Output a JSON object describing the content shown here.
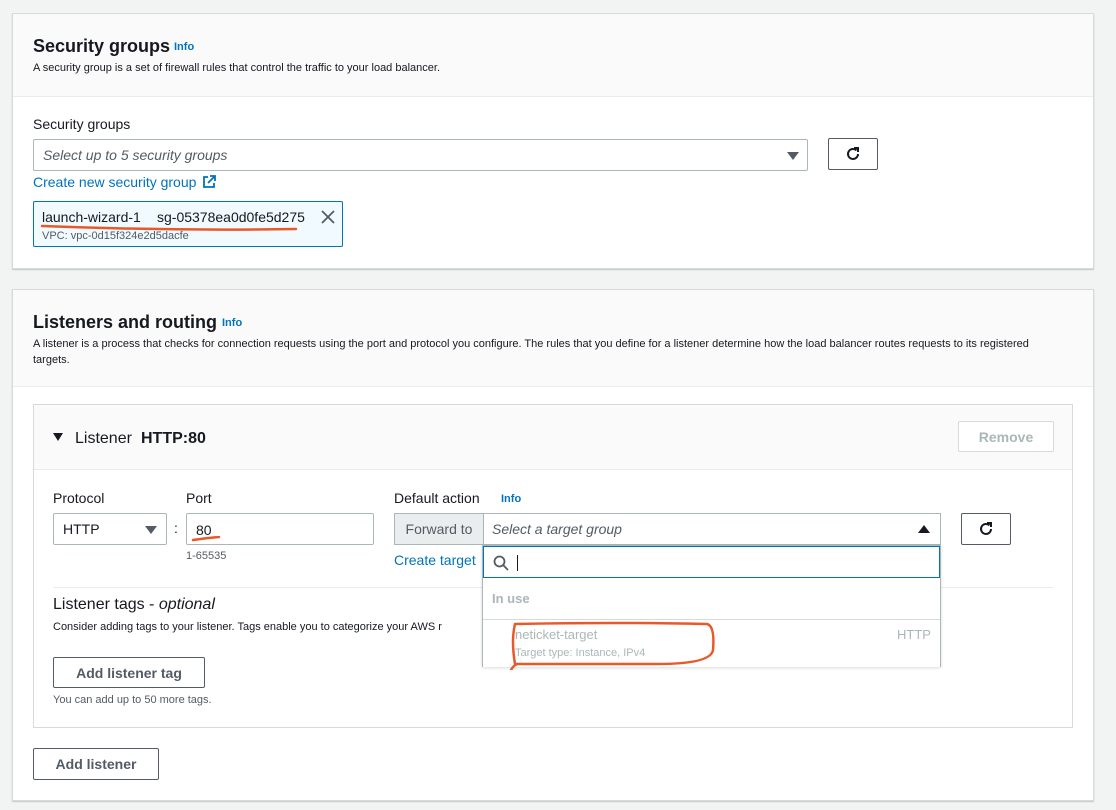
{
  "security_groups": {
    "title": "Security groups",
    "info": "Info",
    "description": "A security group is a set of firewall rules that control the traffic to your load balancer.",
    "field_label": "Security groups",
    "select_placeholder": "Select up to 5 security groups",
    "create_link": "Create new security group",
    "selected_token": {
      "name": "launch-wizard-1",
      "id": "sg-05378ea0d0fe5d275",
      "vpc": "VPC: vpc-0d15f324e2d5dacfe"
    }
  },
  "listeners": {
    "title": "Listeners and routing",
    "info": "Info",
    "description": "A listener is a process that checks for connection requests using the port and protocol you configure. The rules that you define for a listener determine how the load balancer routes requests to its registered targets.",
    "listener": {
      "name": "Listener",
      "protocol_port": "HTTP:80",
      "remove_label": "Remove",
      "protocol_label": "Protocol",
      "protocol_value": "HTTP",
      "colon": ":",
      "port_label": "Port",
      "port_value": "80",
      "port_hint": "1-65535",
      "default_action_label": "Default action",
      "default_action_info": "Info",
      "forward_to": "Forward to",
      "target_placeholder": "Select a target group",
      "create_target_link": "Create target",
      "tags_title": "Listener tags",
      "tags_optional": "optional",
      "tags_desc": "Consider adding tags to your listener. Tags enable you to categorize your AWS r",
      "add_tag_label": "Add listener tag",
      "tags_hint": "You can add up to 50 more tags."
    },
    "dropdown": {
      "group_label": "In use",
      "option_name": "neticket-target",
      "option_protocol": "HTTP",
      "option_desc": "Target type: Instance, IPv4"
    },
    "add_listener_label": "Add listener"
  },
  "colors": {
    "accent": "#0073bb",
    "annotation": "#e8592a"
  }
}
